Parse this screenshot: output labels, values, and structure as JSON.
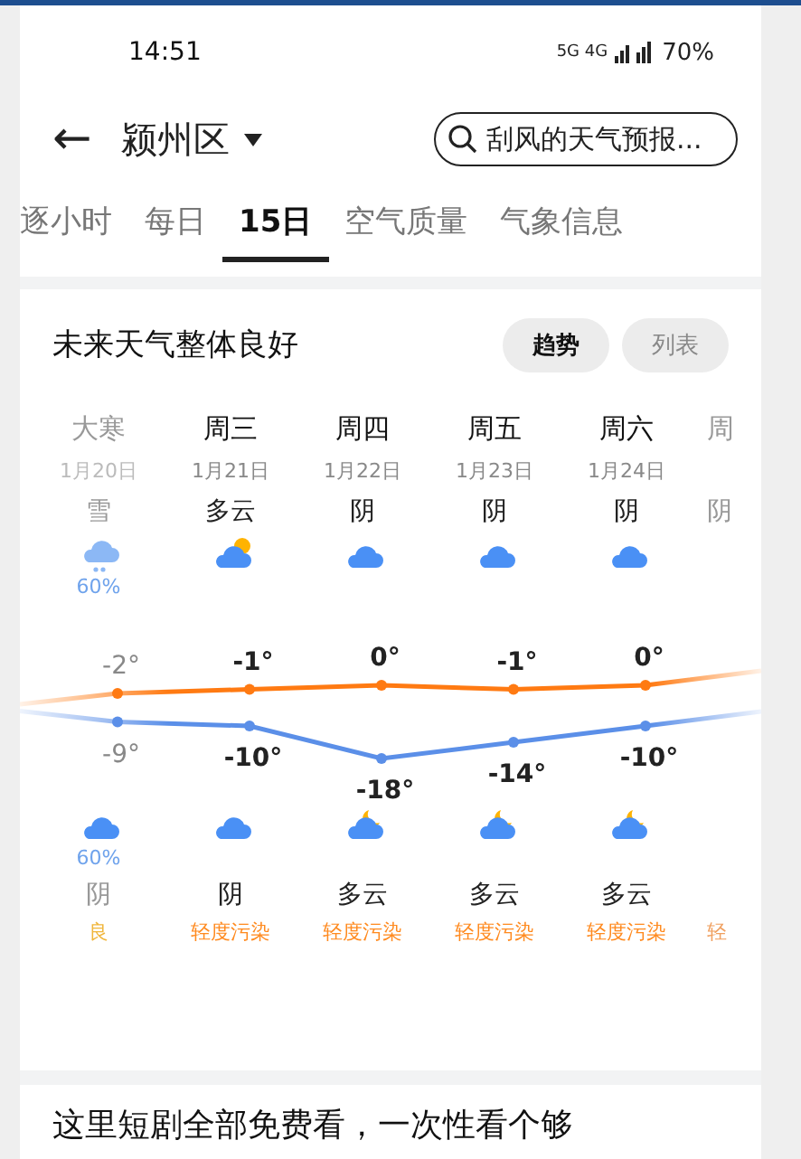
{
  "status_bar": {
    "time": "14:51",
    "network": "5G 4G",
    "battery": "70%"
  },
  "header": {
    "back": "←",
    "city": "颍州区",
    "search": {
      "placeholder": "刮风的天气预报..."
    }
  },
  "tabs": [
    {
      "label": "逐小时",
      "selected": false
    },
    {
      "label": "每日",
      "selected": false
    },
    {
      "label": "15日",
      "selected": true
    },
    {
      "label": "空气质量",
      "selected": false
    },
    {
      "label": "气象信息",
      "selected": false
    }
  ],
  "forecast": {
    "title": "未来天气整体良好",
    "views": [
      {
        "label": "趋势",
        "selected": true
      },
      {
        "label": "列表",
        "selected": false
      }
    ],
    "days": [
      {
        "name": "大寒",
        "date": "1月20日",
        "past": true,
        "day": {
          "kind": "snow",
          "weather": "雪",
          "precip": "60%"
        },
        "high": "-2°",
        "low": "-9°",
        "night": {
          "kind": "cloud",
          "weather": "阴",
          "precip": "60%"
        },
        "aqi": "良",
        "color": "#f0b63c"
      },
      {
        "name": "周三",
        "date": "1月21日",
        "past": false,
        "day": {
          "kind": "partly",
          "weather": "多云"
        },
        "high": "-1°",
        "low": "-10°",
        "night": {
          "kind": "cloud",
          "weather": "阴"
        },
        "aqi": "轻度污染",
        "color": "#ff8a1f"
      },
      {
        "name": "周四",
        "date": "1月22日",
        "past": false,
        "day": {
          "kind": "cloud",
          "weather": "阴"
        },
        "high": "0°",
        "low": "-18°",
        "night": {
          "kind": "moon",
          "weather": "多云"
        },
        "aqi": "轻度污染",
        "color": "#ff8a1f"
      },
      {
        "name": "周五",
        "date": "1月23日",
        "past": false,
        "day": {
          "kind": "cloud",
          "weather": "阴"
        },
        "high": "-1°",
        "low": "-14°",
        "night": {
          "kind": "moon",
          "weather": "多云"
        },
        "aqi": "轻度污染",
        "color": "#ff8a1f"
      },
      {
        "name": "周六",
        "date": "1月24日",
        "past": false,
        "day": {
          "kind": "cloud",
          "weather": "阴"
        },
        "high": "0°",
        "low": "-10°",
        "night": {
          "kind": "moon",
          "weather": "多云"
        },
        "aqi": "轻度污染",
        "color": "#ff8a1f"
      }
    ],
    "partial_day": {
      "name": "周",
      "weather": "阴",
      "aqi": "轻"
    }
  },
  "promo": {
    "text": "这里短剧全部免费看，一次性看个够"
  }
}
